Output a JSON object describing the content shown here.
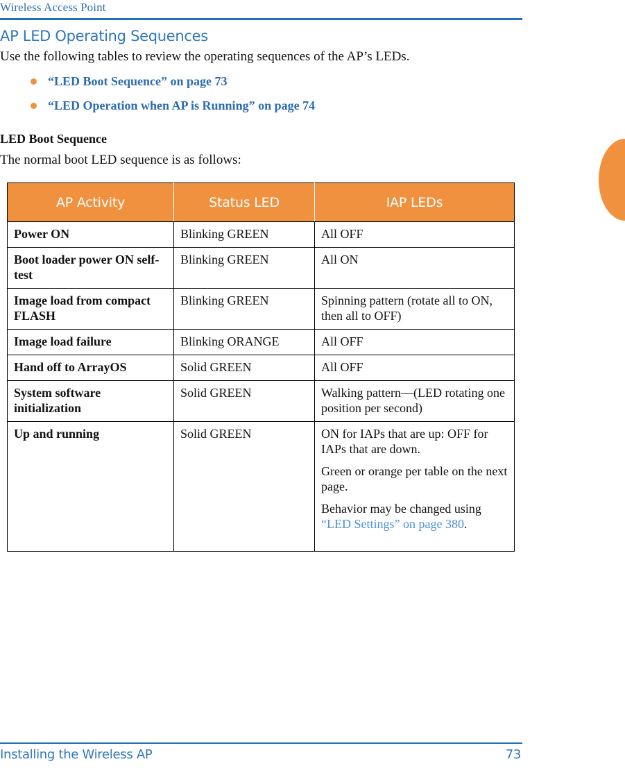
{
  "header": {
    "running_title": "Wireless Access Point"
  },
  "edge_tab": {
    "color": "#f0913f"
  },
  "main": {
    "section_title": "AP LED Operating Sequences",
    "intro": "Use the following tables to review the operating sequences of the AP’s LEDs.",
    "xref_list": [
      {
        "label": "“LED Boot Sequence” on page 73"
      },
      {
        "label": "“LED Operation when AP is Running” on page 74"
      }
    ],
    "sub_title": "LED Boot Sequence",
    "lead": "The normal boot LED sequence is as follows:"
  },
  "table": {
    "headers": [
      "AP Activity",
      "Status LED",
      "IAP LEDs"
    ],
    "rows": [
      {
        "activity": "Power ON",
        "status_led": "Blinking GREEN",
        "iap_leds": [
          "All OFF"
        ]
      },
      {
        "activity": "Boot loader power ON self-test",
        "status_led": "Blinking GREEN",
        "iap_leds": [
          "All ON"
        ]
      },
      {
        "activity": "Image load from compact FLASH",
        "status_led": "Blinking GREEN",
        "iap_leds": [
          "Spinning pattern (rotate all to ON, then all to OFF)"
        ]
      },
      {
        "activity": "Image load failure",
        "status_led": "Blinking ORANGE",
        "iap_leds": [
          "All OFF"
        ]
      },
      {
        "activity": "Hand off to ArrayOS",
        "status_led": "Solid GREEN",
        "iap_leds": [
          "All OFF"
        ]
      },
      {
        "activity": "System software initialization",
        "status_led": "Solid GREEN",
        "iap_leds": [
          "Walking pattern—(LED rotating one position per second)"
        ]
      },
      {
        "activity": "Up and running",
        "status_led": "Solid GREEN",
        "iap_leds": [
          "ON for IAPs that are up: OFF for IAPs that are down.",
          "Green or orange per table on the next page."
        ],
        "iap_last_prefix": "Behavior may be changed using ",
        "iap_last_link": "“LED Settings” on page 380",
        "iap_last_suffix": "."
      }
    ]
  },
  "footer": {
    "left": "Installing the Wireless AP",
    "page_number": "73"
  },
  "colors": {
    "accent_orange": "#f0913f",
    "heading_blue": "#2f76b9",
    "link_blue": "#2b6cb0",
    "xref_blue": "#4a90d9",
    "rule_blue": "#2170b8"
  }
}
